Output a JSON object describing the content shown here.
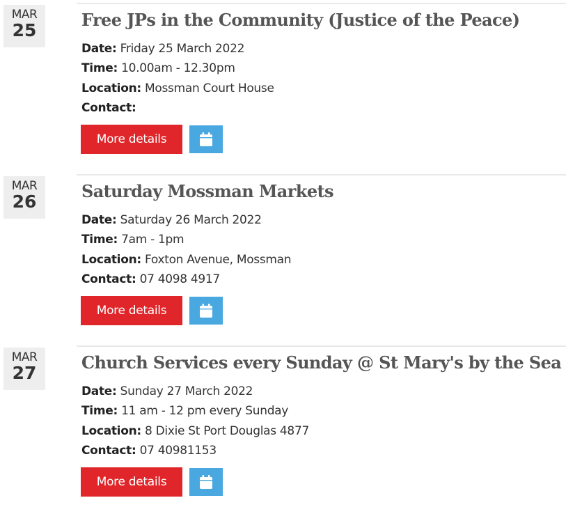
{
  "events": [
    {
      "month": "MAR",
      "day": "25",
      "title": "Free JPs in the Community (Justice of the Peace)",
      "date_label": "Date:",
      "date_value": " Friday 25 March 2022",
      "time_label": "Time:",
      "time_value": " 10.00am - 12.30pm",
      "location_label": "Location:",
      "location_value": " Mossman Court House",
      "contact_label": "Contact:",
      "contact_value": "",
      "more_label": "More details",
      "calendar_icon": "calendar-icon"
    },
    {
      "month": "MAR",
      "day": "26",
      "title": "Saturday Mossman Markets",
      "date_label": "Date:",
      "date_value": " Saturday 26 March 2022",
      "time_label": "Time:",
      "time_value": " 7am - 1pm",
      "location_label": "Location:",
      "location_value": " Foxton Avenue, Mossman",
      "contact_label": "Contact:",
      "contact_value": " 07 4098 4917",
      "more_label": "More details",
      "calendar_icon": "calendar-icon"
    },
    {
      "month": "MAR",
      "day": "27",
      "title": "Church Services every Sunday @ St Mary's by the Sea",
      "date_label": "Date:",
      "date_value": " Sunday 27 March 2022",
      "time_label": "Time:",
      "time_value": " 11 am - 12 pm every Sunday",
      "location_label": "Location:",
      "location_value": " 8 Dixie St Port Douglas 4877",
      "contact_label": "Contact:",
      "contact_value": " 07 40981153",
      "more_label": "More details",
      "calendar_icon": "calendar-icon"
    }
  ],
  "colors": {
    "more_button": "#e0262a",
    "calendar_button": "#49a8e0",
    "date_badge": "#eeeeee",
    "title_text": "#555555"
  }
}
